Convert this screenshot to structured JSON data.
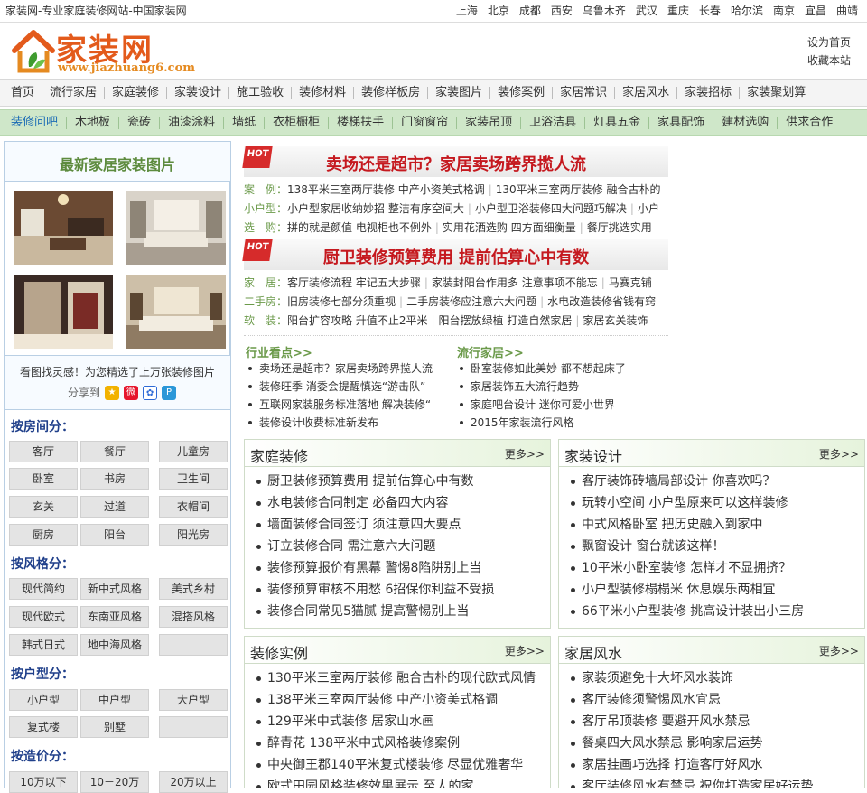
{
  "topbar": {
    "site_title": "家装网-专业家庭装修网站-中国家装网",
    "cities": [
      "上海",
      "北京",
      "成都",
      "西安",
      "乌鲁木齐",
      "武汉",
      "重庆",
      "长春",
      "哈尔滨",
      "南京",
      "宜昌",
      "曲靖"
    ]
  },
  "logo": {
    "cn": "家装网",
    "en": "www.jiazhuang6.com"
  },
  "quick_links": {
    "homepage": "设为首页",
    "favorite": "收藏本站"
  },
  "nav_main": [
    "首页",
    "流行家居",
    "家庭装修",
    "家装设计",
    "施工验收",
    "装修材料",
    "装修样板房",
    "家装图片",
    "装修案例",
    "家居常识",
    "家居风水",
    "家装招标",
    "家装聚划算"
  ],
  "nav_sub": [
    "装修问吧",
    "木地板",
    "瓷砖",
    "油漆涂料",
    "墙纸",
    "衣柜橱柜",
    "楼梯扶手",
    "门窗窗帘",
    "家装吊顶",
    "卫浴洁具",
    "灯具五金",
    "家具配饰",
    "建材选购",
    "供求合作"
  ],
  "sidebar": {
    "gallery_title": "最新家居家装图片",
    "tip": "看图找灵感！为您精选了上万张装修图片",
    "share_label": "分享到",
    "room_heading": "按房间分：",
    "rooms": [
      "客厅",
      "餐厅",
      "儿童房",
      "卧室",
      "书房",
      "卫生间",
      "玄关",
      "过道",
      "衣帽间",
      "厨房",
      "阳台",
      "阳光房"
    ],
    "style_heading": "按风格分：",
    "styles": [
      "现代简约",
      "新中式风格",
      "美式乡村",
      "现代欧式",
      "东南亚风格",
      "混搭风格",
      "韩式日式",
      "地中海风格",
      ""
    ],
    "type_heading": "按户型分：",
    "types": [
      "小户型",
      "中户型",
      "大户型",
      "复式楼",
      "别墅",
      ""
    ],
    "price_heading": "按造价分：",
    "prices": [
      "10万以下",
      "10－20万",
      "20万以上"
    ]
  },
  "headline1": {
    "badge": "HOT",
    "title": "卖场还是超市？家居卖场跨界揽人流",
    "rows": [
      {
        "key": "案　例：",
        "items": [
          "138平米三室两厅装修 中产小资美式格调",
          "130平米三室两厅装修 融合古朴的"
        ]
      },
      {
        "key": "小户型：",
        "items": [
          "小户型家居收纳妙招 整洁有序空间大",
          "小户型卫浴装修四大问题巧解决",
          "小户"
        ]
      },
      {
        "key": "选　购：",
        "items": [
          "拼的就是颜值 电视柜也不例外",
          "实用花洒选购 四方面细衡量",
          "餐厅挑选实用"
        ]
      }
    ]
  },
  "headline2": {
    "badge": "HOT",
    "title": "厨卫装修预算费用 提前估算心中有数",
    "rows": [
      {
        "key": "家　居：",
        "items": [
          "客厅装修流程 牢记五大步骤",
          "家装封阳台作用多 注意事项不能忘",
          "马赛克铺"
        ]
      },
      {
        "key": "二手房：",
        "items": [
          "旧房装修七部分须重视",
          "二手房装修应注意六大问题",
          "水电改造装修省钱有窍"
        ]
      },
      {
        "key": "软　装：",
        "items": [
          "阳台扩容攻略 升值不止2平米",
          "阳台摆放绿植 打造自然家居",
          "家居玄关装饰"
        ]
      }
    ]
  },
  "industry": {
    "heading": "行业看点>>",
    "items": [
      "卖场还是超市？家居卖场跨界揽人流",
      "装修旺季 消委会提醒慎选“游击队”",
      "互联网家装服务标准落地 解决装修“",
      "装修设计收费标准新发布"
    ]
  },
  "trend": {
    "heading": "流行家居>>",
    "items": [
      "卧室装修如此美妙 都不想起床了",
      "家居装饰五大流行趋势",
      "家庭吧台设计 迷你可爱小世界",
      "2015年家装流行风格"
    ]
  },
  "boxes": [
    {
      "title": "家庭装修",
      "more": "更多>>",
      "items": [
        "厨卫装修预算费用 提前估算心中有数",
        "水电装修合同制定 必备四大内容",
        "墙面装修合同签订 须注意四大要点",
        "订立装修合同 需注意六大问题",
        "装修预算报价有黑幕 警惕8陷阱别上当",
        "装修预算审核不用愁 6招保你利益不受损",
        "装修合同常见5猫腻 提高警惕别上当"
      ]
    },
    {
      "title": "家装设计",
      "more": "更多>>",
      "items": [
        "客厅装饰砖墙局部设计 你喜欢吗？",
        "玩转小空间 小户型原来可以这样装修",
        "中式风格卧室 把历史融入到家中",
        "飘窗设计 窗台就该这样！",
        "10平米小卧室装修 怎样才不显拥挤？",
        "小户型装修榻榻米 休息娱乐两相宜",
        "66平米小户型装修 挑高设计装出小三房"
      ]
    },
    {
      "title": "装修实例",
      "more": "更多>>",
      "items": [
        "130平米三室两厅装修 融合古朴的现代欧式风情",
        "138平米三室两厅装修 中产小资美式格调",
        "129平米中式装修 居家山水画",
        "醉青花 138平米中式风格装修案例",
        "中央御王郡140平米复式楼装修 尽显优雅奢华",
        "欧式田园风格装修效果展示 至人的家"
      ]
    },
    {
      "title": "家居风水",
      "more": "更多>>",
      "items": [
        "家装须避免十大坏风水装饰",
        "客厅装修须警惕风水宜忌",
        "客厅吊顶装修 要避开风水禁忌",
        "餐桌四大风水禁忌 影响家居运势",
        "家居挂画巧选择 打造客厅好风水",
        "客厅装修风水有禁忌 祝你打造家居好运势"
      ]
    }
  ]
}
